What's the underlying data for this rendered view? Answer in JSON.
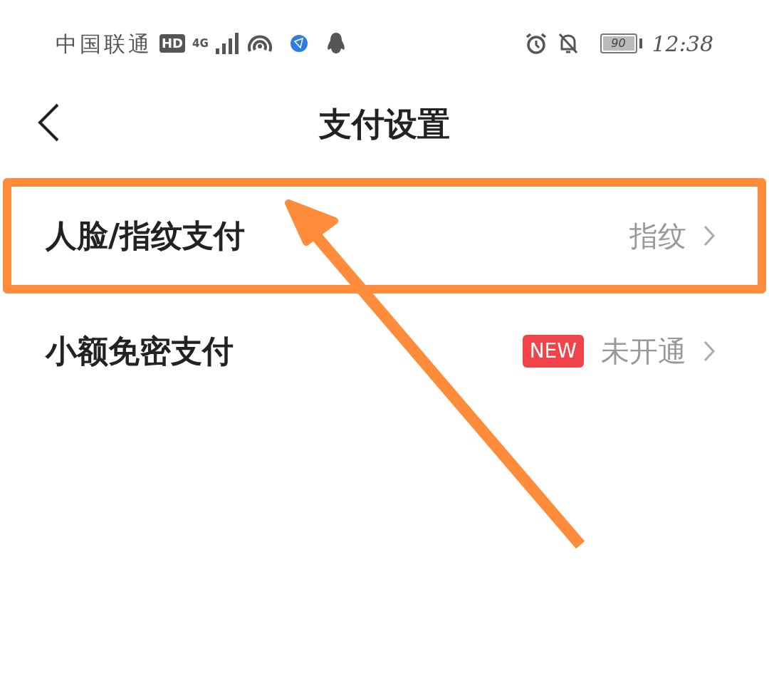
{
  "status_bar": {
    "carrier": "中国联通",
    "hd": "HD",
    "network": "4G",
    "battery": "90",
    "time": "12:38"
  },
  "header": {
    "title": "支付设置"
  },
  "rows": [
    {
      "label": "人脸/指纹支付",
      "value": "指纹",
      "highlighted": true
    },
    {
      "label": "小额免密支付",
      "badge": "NEW",
      "value": "未开通",
      "highlighted": false
    }
  ]
}
